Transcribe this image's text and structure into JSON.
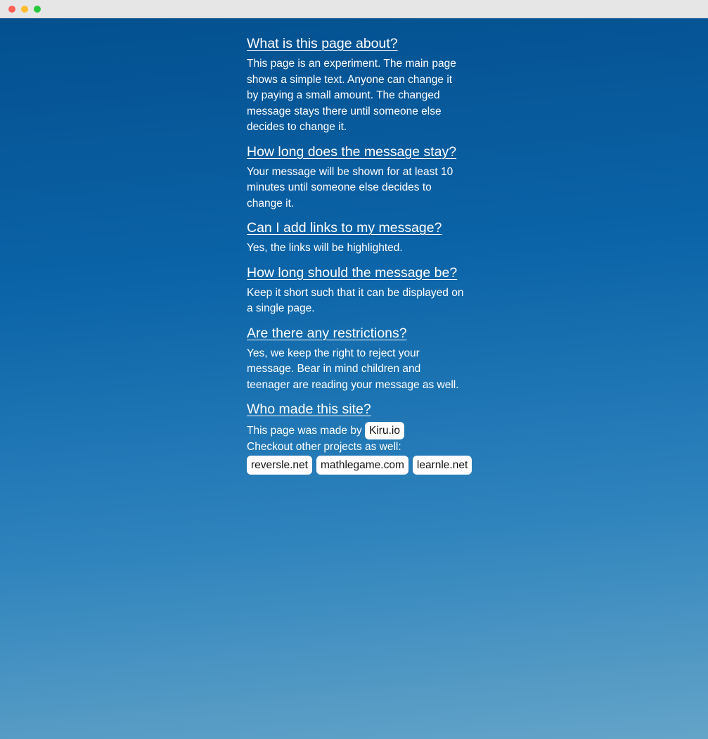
{
  "faq": [
    {
      "question": "What is this page about?",
      "answer": "This page is an experiment. The main page shows a simple text. Anyone can change it by paying a small amount. The changed message stays there until someone else decides to change it."
    },
    {
      "question": "How long does the message stay?",
      "answer": "Your message will be shown for at least 10 minutes until someone else decides to change it."
    },
    {
      "question": "Can I add links to my message?",
      "answer": "Yes, the links will be highlighted."
    },
    {
      "question": "How long should the message be?",
      "answer": "Keep it short such that it can be displayed on a single page."
    },
    {
      "question": "Are there any restrictions?",
      "answer": "Yes, we keep the right to reject your message. Bear in mind children and teenager are reading your message as well."
    }
  ],
  "who": {
    "question": "Who made this site?",
    "made_by_text": "This page was made by",
    "made_by_link": "Kiru.io",
    "checkout_text": "Checkout other projects as well:",
    "projects": [
      "reversle.net",
      "mathlegame.com",
      "learnle.net"
    ]
  },
  "colors": {
    "gradient_top": "#03508f",
    "gradient_bottom": "#64a4c8",
    "text": "#ffffff",
    "pill_bg": "#ffffff"
  }
}
